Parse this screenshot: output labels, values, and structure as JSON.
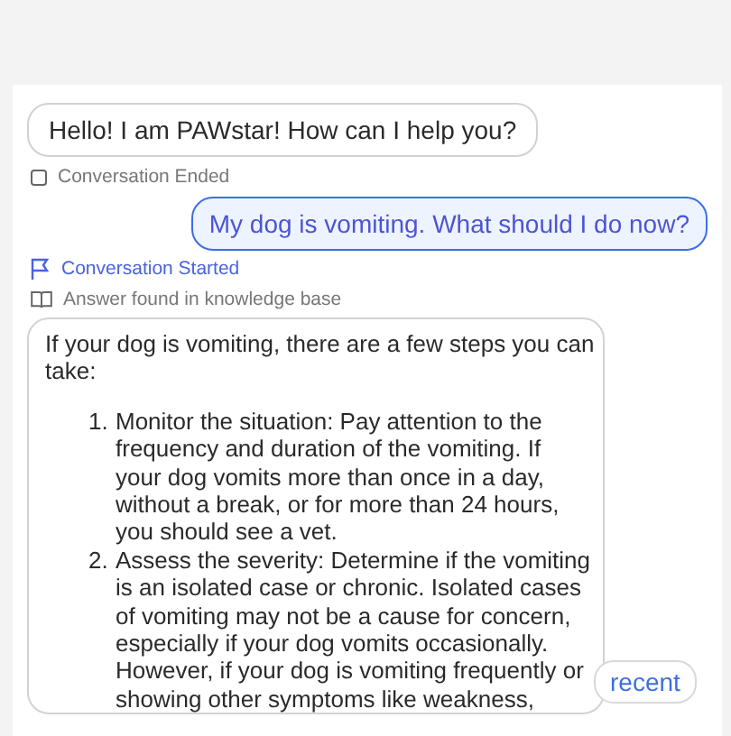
{
  "messages": [
    {
      "kind": "bot",
      "text": "Hello! I am PAWstar! How can I help you?"
    },
    {
      "kind": "ended",
      "text": "Conversation Ended"
    },
    {
      "kind": "user",
      "text": "My dog is vomiting. What should I do now?"
    },
    {
      "kind": "started",
      "text": "Conversation Started"
    },
    {
      "kind": "source",
      "text": "Answer found in knowledge base"
    },
    {
      "kind": "answer",
      "intro": "If your dog is vomiting, there are a few steps you can\ntake:",
      "items": [
        {
          "number": "1.",
          "text": "Monitor the situation: Pay attention to the\nfrequency and duration of the vomiting. If\nyour dog vomits more than once in a day,\nwithout a break, or for more than 24 hours,\nyou should see a vet."
        },
        {
          "number": "2.",
          "text": "Assess the severity: Determine if the vomiting\nis an isolated case or chronic. Isolated cases\nof vomiting may not be a cause for concern,\nespecially if your dog vomits occasionally.\nHowever, if your dog is vomiting frequently or\nshowing other symptoms like weakness,"
        }
      ]
    }
  ],
  "recent_button": "recent"
}
